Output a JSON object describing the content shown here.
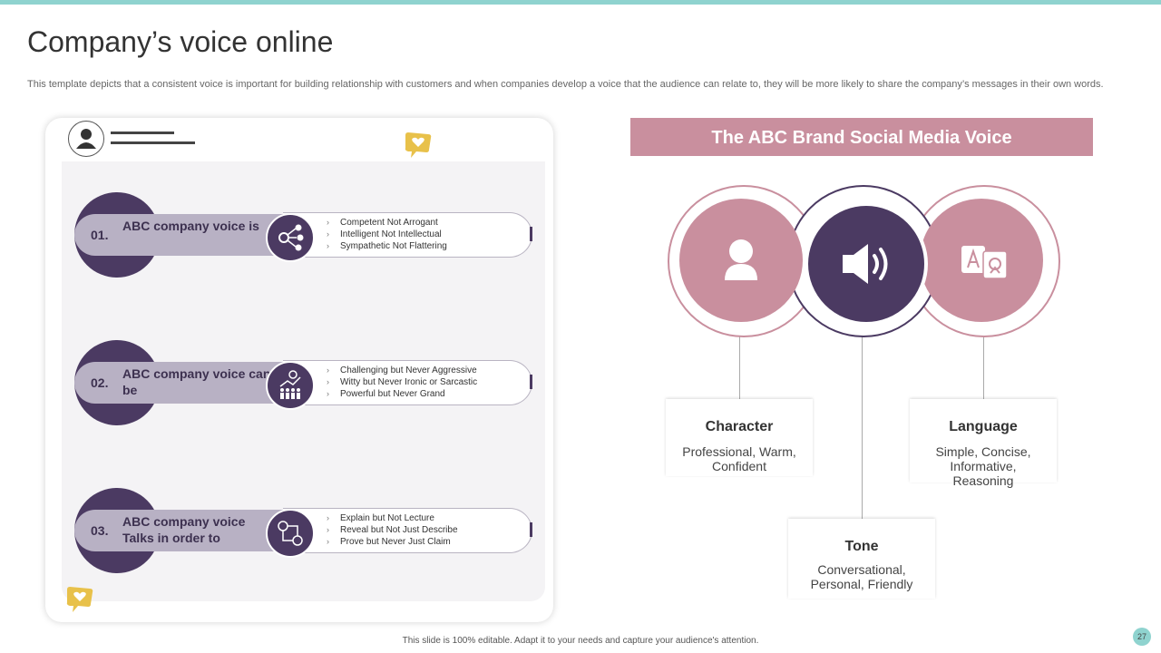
{
  "header": {
    "title": "Company’s voice online",
    "description": "This template depicts that a consistent voice is important for building relationship with customers and when companies develop a voice that the audience can relate to, they will be more likely to share the company’s messages in their own words."
  },
  "left_panel": {
    "rows": [
      {
        "number": "01.",
        "label": "ABC company voice is",
        "icon": "people-network-icon",
        "bullets": [
          "Competent Not Arrogant",
          "Intelligent Not Intellectual",
          "Sympathetic Not Flattering"
        ]
      },
      {
        "number": "02.",
        "label": "ABC company voice can be",
        "icon": "growth-team-icon",
        "bullets": [
          "Challenging  but Never Aggressive",
          "Witty but Never Ironic or Sarcastic",
          "Powerful but Never Grand"
        ]
      },
      {
        "number": "03.",
        "label": "ABC company voice Talks in order to",
        "icon": "communication-flow-icon",
        "bullets": [
          "Explain but Not Lecture",
          "Reveal but Not Just Describe",
          "Prove but Never Just Claim"
        ]
      }
    ]
  },
  "right_panel": {
    "banner": "The ABC Brand Social Media Voice",
    "circles": [
      {
        "icon": "person-icon",
        "color": "#c98f9e"
      },
      {
        "icon": "speaker-icon",
        "color": "#4b3a62"
      },
      {
        "icon": "translate-icon",
        "color": "#c98f9e"
      }
    ],
    "boxes": {
      "character": {
        "title": "Character",
        "text": "Professional, Warm, Confident"
      },
      "language": {
        "title": "Language",
        "text": "Simple, Concise, Informative, Reasoning"
      },
      "tone": {
        "title": "Tone",
        "text": "Conversational, Personal, Friendly"
      }
    }
  },
  "footer": {
    "note": "This slide is 100% editable. Adapt it to your needs and capture your audience's attention.",
    "page": "27"
  },
  "colors": {
    "accent_teal": "#8fd3cf",
    "purple": "#4b3a62",
    "pink": "#c98f9e",
    "gold": "#e8c14a"
  }
}
